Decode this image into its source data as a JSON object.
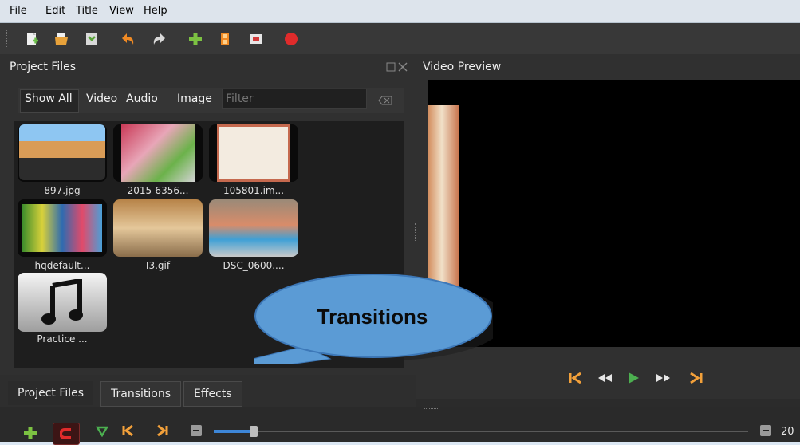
{
  "menu": {
    "items": [
      "File",
      "Edit",
      "Title",
      "View",
      "Help"
    ]
  },
  "toolbar": {
    "icons": [
      "new-project-icon",
      "open-project-icon",
      "save-project-icon",
      "undo-icon",
      "redo-icon",
      "add-file-icon",
      "film-icon",
      "export-film-icon",
      "record-icon"
    ]
  },
  "project_files": {
    "title": "Project Files",
    "filters": [
      "Show All",
      "Video",
      "Audio",
      "Image"
    ],
    "filter_placeholder": "Filter",
    "files": [
      {
        "label": "897.jpg"
      },
      {
        "label": "2015-6356..."
      },
      {
        "label": "105801.im..."
      },
      {
        "label": "hqdefault..."
      },
      {
        "label": "I3.gif"
      },
      {
        "label": "DSC_0600...."
      },
      {
        "label": "Practice ..."
      }
    ]
  },
  "video_preview": {
    "title": "Video Preview"
  },
  "bottom_tabs": [
    "Project Files",
    "Transitions",
    "Effects"
  ],
  "callout": {
    "text": "Transitions"
  },
  "timeline": {
    "zoom_text": "20"
  },
  "colors": {
    "accent_orange": "#f2a03a",
    "play_green": "#4caf50",
    "record_red": "#e02b2b",
    "callout_blue": "#5b9bd5"
  }
}
